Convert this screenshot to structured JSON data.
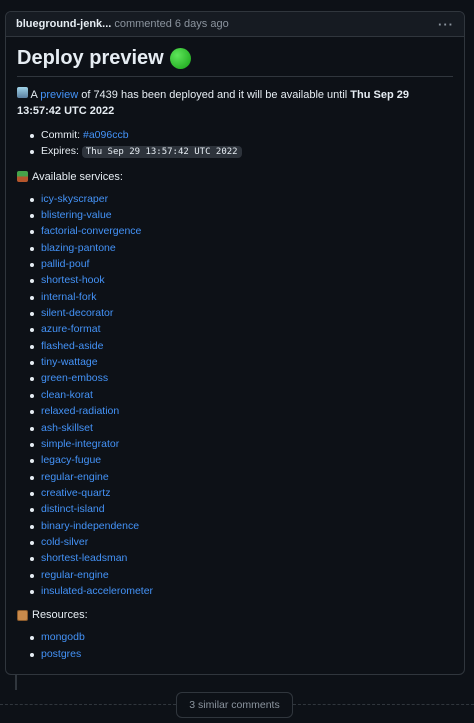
{
  "comment": {
    "author": "blueground-jenk...",
    "meta": "commented 6 days ago",
    "menu_icon": "kebab-horizontal-icon",
    "menu_glyph": "···"
  },
  "body": {
    "title": "Deploy preview",
    "summary_prefix": " A ",
    "summary_link": "preview",
    "summary_middle": " of 7439 has been deployed and it will be available until ",
    "summary_date": "Thu Sep 29 13:57:42 UTC 2022",
    "commit_label": "Commit: ",
    "commit_value": "#a096ccb",
    "expires_label": "Expires: ",
    "expires_value": "Thu Sep 29 13:57:42 UTC 2022",
    "services_label": "Available services:",
    "services": [
      "icy-skyscraper",
      "blistering-value",
      "factorial-convergence",
      "blazing-pantone",
      "pallid-pouf",
      "shortest-hook",
      "internal-fork",
      "silent-decorator",
      "azure-format",
      "flashed-aside",
      "tiny-wattage",
      "green-emboss",
      "clean-korat",
      "relaxed-radiation",
      "ash-skillset",
      "simple-integrator",
      "legacy-fugue",
      "regular-engine",
      "creative-quartz",
      "distinct-island",
      "binary-independence",
      "cold-silver",
      "shortest-leadsman",
      "regular-engine",
      "insulated-accelerometer"
    ],
    "resources_label": "Resources:",
    "resources": [
      "mongodb",
      "postgres"
    ]
  },
  "footer": {
    "similar_label": "3 similar comments"
  }
}
